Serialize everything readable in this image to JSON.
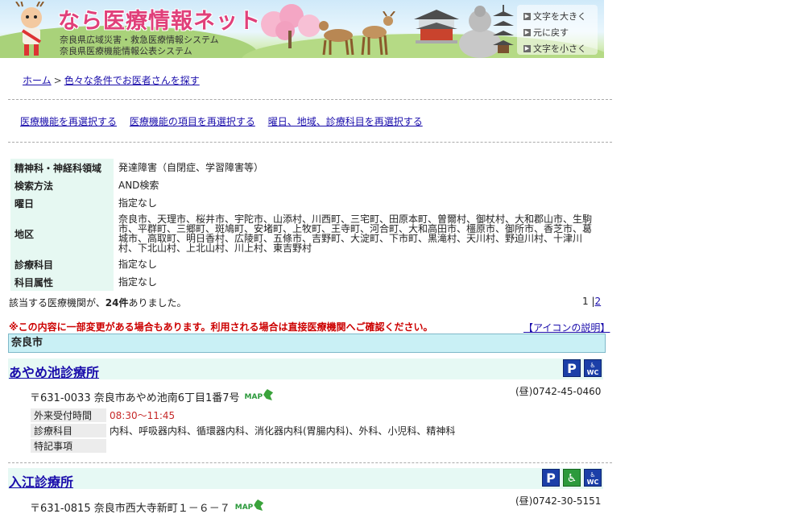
{
  "header": {
    "site_title": "なら医療情報ネット",
    "subtitle_1": "奈良県広域災害・救急医療情報システム",
    "subtitle_2": "奈良県医療機能情報公表システム",
    "text_size": {
      "larger": "文字を大きく",
      "reset": "元に戻す",
      "smaller": "文字を小さく"
    }
  },
  "breadcrumb": {
    "home": "ホーム",
    "separator": ">",
    "current": "色々な条件でお医者さんを探す"
  },
  "reselect_links": [
    "医療機能を再選択する",
    "医療機能の項目を再選択する",
    "曜日、地域、診療科目を再選択する"
  ],
  "criteria": {
    "rows": [
      {
        "label": "精神科・神経科領域",
        "value": "発達障害（自閉症、学習障害等）"
      },
      {
        "label": "検索方法",
        "value": "AND検索"
      },
      {
        "label": "曜日",
        "value": "指定なし"
      },
      {
        "label": "地区",
        "value": "奈良市、天理市、桜井市、宇陀市、山添村、川西町、三宅町、田原本町、曽爾村、御杖村、大和郡山市、生駒市、平群町、三郷町、斑鳩町、安堵町、上牧町、王寺町、河合町、大和高田市、橿原市、御所市、香芝市、葛城市、高取町、明日香村、広陵町、五條市、吉野町、大淀町、下市町、黒滝村、天川村、野迫川村、十津川村、下北山村、上北山村、川上村、東吉野村"
      },
      {
        "label": "診療科目",
        "value": "指定なし"
      },
      {
        "label": "科目属性",
        "value": "指定なし"
      }
    ]
  },
  "result": {
    "prefix": "該当する医療機関が、",
    "count": "24件",
    "suffix": "ありました。"
  },
  "pager": {
    "current": "1",
    "separator": "|",
    "next": "2"
  },
  "warning": "※この内容に一部変更がある場合もあります。利用される場合は直接医療機関へご確認ください。",
  "icon_help": "【アイコンの説明】",
  "region": "奈良市",
  "facilities": [
    {
      "name": "あやめ池診療所",
      "address": "〒631-0033 奈良市あやめ池南6丁目1番7号",
      "map_label": "MAP",
      "tel": "(昼)0742-45-0460",
      "details": [
        {
          "label": "外来受付時間",
          "value": "08:30～11:45"
        },
        {
          "label": "診療科目",
          "value": "内科、呼吸器内科、循環器内科、消化器内科(胃腸内科)、外科、小児科、精神科"
        },
        {
          "label": "特記事項",
          "value": ""
        }
      ],
      "icons": [
        "parking-icon",
        "accessible-toilet-icon"
      ]
    },
    {
      "name": "入江診療所",
      "address": "〒631-0815 奈良市西大寺新町１－６－７",
      "map_label": "MAP",
      "tel": "(昼)0742-30-5151",
      "icons": [
        "parking-icon",
        "wheelchair-icon",
        "accessible-toilet-icon"
      ]
    }
  ],
  "icon_labels": {
    "parking": "P",
    "toilet": "WC"
  }
}
